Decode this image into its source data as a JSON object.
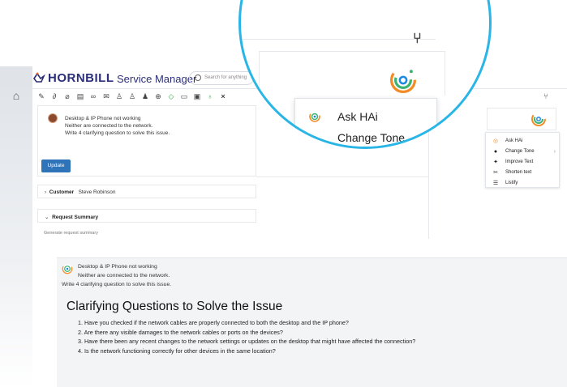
{
  "topbar": {
    "brand": "HORNBILL",
    "app_name": "Service Manager",
    "search_placeholder": "Search for anything"
  },
  "request": {
    "lines": [
      "Desktop & IP Phone not working",
      "Neither are connected to the network.",
      "Write 4 clarifying question to solve this issue."
    ],
    "update_label": "Update"
  },
  "sections": {
    "customer_label": "Customer",
    "customer_value": "Steve Robinson",
    "summary_label": "Request Summary",
    "summary_hint": "Generate request summary"
  },
  "ai_menu": {
    "items": [
      {
        "label": "Ask HAi",
        "icon": "hai-logo-icon"
      },
      {
        "label": "Change Tone",
        "icon": "speech-bubble-icon",
        "has_submenu": true
      },
      {
        "label": "Improve Text",
        "icon": "sparkle-icon"
      },
      {
        "label": "Shorten text",
        "icon": "scissors-icon"
      },
      {
        "label": "Listify",
        "icon": "list-icon"
      }
    ]
  },
  "result": {
    "prompt_lines": [
      "Desktop & IP Phone not working",
      "Neither are connected to the network.",
      "Write 4 clarifying question to solve this issue."
    ],
    "title": "Clarifying Questions to Solve the Issue",
    "questions": [
      "1. Have you checked if the network cables are properly connected to both the desktop and the IP phone?",
      "2. Are there any visible damages to the network cables or ports on the devices?",
      "3. Have there been any recent changes to the network settings or updates on the desktop that might have affected the connection?",
      "4. Is the network functioning correctly for other devices in the same location?"
    ]
  },
  "colors": {
    "brand": "#2b2f7a",
    "accent": "#29b6e6",
    "button": "#2f73b8"
  }
}
